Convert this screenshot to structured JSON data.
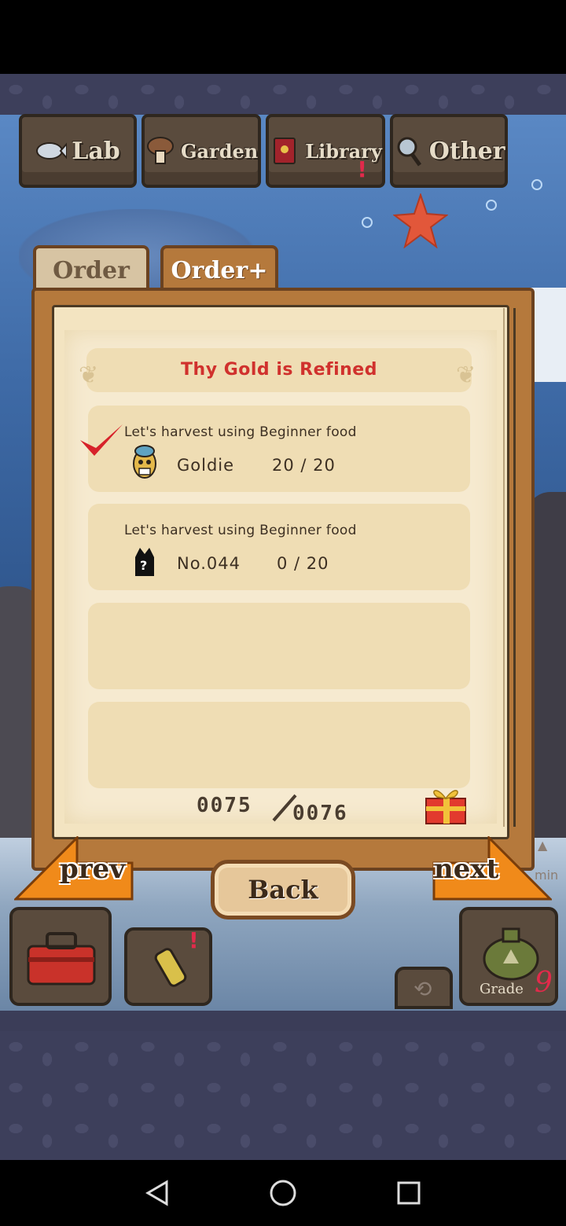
{
  "top_menu": {
    "lab": "Lab",
    "garden": "Garden",
    "library": "Library",
    "other": "Other"
  },
  "tabs": [
    {
      "label": "Order",
      "active": false
    },
    {
      "label": "Order+",
      "active": true
    }
  ],
  "order": {
    "title": "Thy Gold is Refined",
    "tasks": [
      {
        "description": "Let's harvest using Beginner food",
        "name": "Goldie",
        "progress": "20 / 20",
        "completed": true,
        "icon": "goldie-icon"
      },
      {
        "description": "Let's harvest using Beginner food",
        "name": "No.044",
        "progress": "0 / 20",
        "completed": false,
        "icon": "unknown-creature-icon"
      }
    ],
    "counter_current": "0075",
    "counter_total": "0076"
  },
  "buttons": {
    "prev": "prev",
    "back": "Back",
    "next": "next"
  },
  "bottom_bar": {
    "grade_label": "Grade",
    "grade_value": "9",
    "min_label": "min"
  },
  "colors": {
    "title_red": "#d0312d",
    "panel_brown": "#b5793c",
    "parchment": "#f3e4c1",
    "nav_orange": "#f08a1a"
  }
}
